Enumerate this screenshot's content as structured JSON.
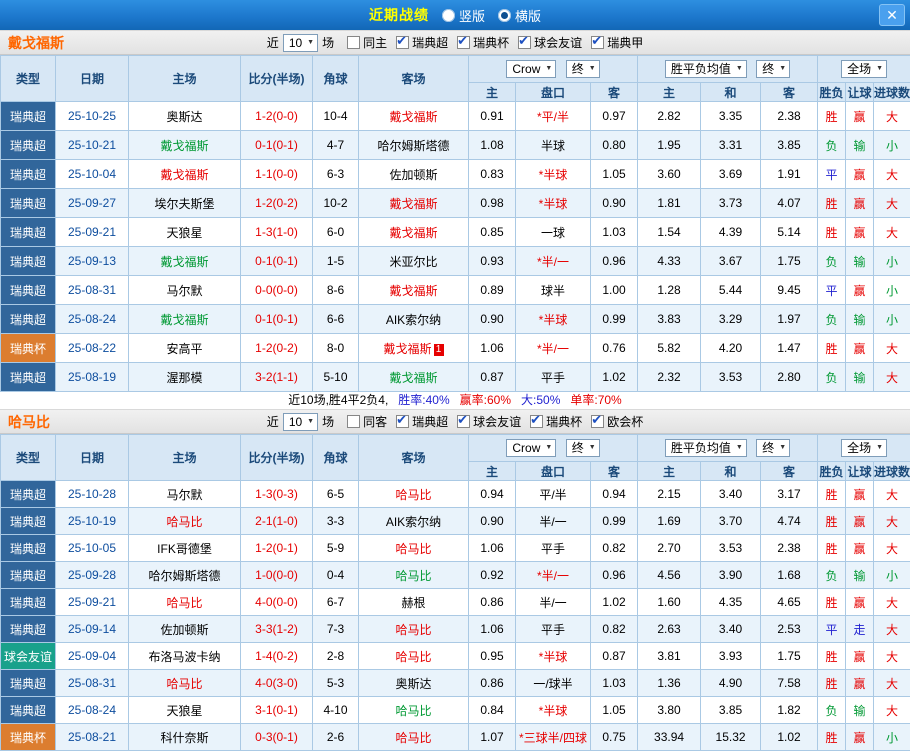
{
  "titlebar": {
    "title": "近期战绩",
    "radios": [
      {
        "key": "vertical",
        "label": "竖版",
        "selected": false
      },
      {
        "key": "horizontal",
        "label": "横版",
        "selected": true
      }
    ]
  },
  "icons": {
    "chevron_down": "▼",
    "close": "✕",
    "check": "✔"
  },
  "palette": {
    "topbar_blue": "#1d78cd",
    "title_yellow": "#ffff00",
    "team_orange": "#ff6600",
    "league_blue": "#31669b",
    "cup_orange": "#dc7d2f",
    "friendly_teal": "#19a18b",
    "win_red": "#e60000",
    "lose_green": "#009933",
    "draw_blue": "#1f1fd0"
  },
  "table_headers": {
    "type": "类型",
    "date": "日期",
    "home": "主场",
    "score": "比分(半场)",
    "corner": "角球",
    "away": "客场",
    "odds_home": "主",
    "handicap": "盘口",
    "odds_away": "客",
    "avg_home": "主",
    "avg_draw": "和",
    "avg_away": "客",
    "result": "胜负",
    "let": "让球",
    "goals": "进球数"
  },
  "sections": [
    {
      "team": "戴戈福斯",
      "filter": {
        "near": "近",
        "count": "10",
        "games": "场",
        "checkboxes": [
          {
            "key": "same-home",
            "label": "同主",
            "checked": false
          },
          {
            "key": "swe-allsvenskan",
            "label": "瑞典超",
            "checked": true
          },
          {
            "key": "swe-cup",
            "label": "瑞典杯",
            "checked": true
          },
          {
            "key": "club-friendly",
            "label": "球会友谊",
            "checked": true
          },
          {
            "key": "swe-superettan",
            "label": "瑞典甲",
            "checked": true
          }
        ]
      },
      "selects": {
        "source": "Crow",
        "time1": "终",
        "avg": "胜平负均值",
        "time2": "终",
        "scope": "全场"
      },
      "rows": [
        {
          "type": "瑞典超",
          "tc": "lg",
          "date": "25-10-25",
          "home": "奥斯达",
          "hc": "k",
          "score": "1-2(0-0)",
          "corner": "10-4",
          "away": "戴戈福斯",
          "ac": "r",
          "oH": "0.91",
          "cap": "*平/半",
          "cc": "r",
          "oA": "0.97",
          "aH": "2.82",
          "aD": "3.35",
          "aA": "2.38",
          "res": "胜",
          "rc": "r",
          "let": "赢",
          "lc": "r",
          "goal": "大",
          "gc": "r"
        },
        {
          "type": "瑞典超",
          "tc": "lg",
          "date": "25-10-21",
          "home": "戴戈福斯",
          "hc": "g",
          "score": "0-1(0-1)",
          "corner": "4-7",
          "away": "哈尔姆斯塔德",
          "ac": "k",
          "oH": "1.08",
          "cap": "半球",
          "cc": "k",
          "oA": "0.80",
          "aH": "1.95",
          "aD": "3.31",
          "aA": "3.85",
          "res": "负",
          "rc": "g",
          "let": "输",
          "lc": "g",
          "goal": "小",
          "gc": "g"
        },
        {
          "type": "瑞典超",
          "tc": "lg",
          "date": "25-10-04",
          "home": "戴戈福斯",
          "hc": "r",
          "score": "1-1(0-0)",
          "corner": "6-3",
          "away": "佐加顿斯",
          "ac": "k",
          "oH": "0.83",
          "cap": "*半球",
          "cc": "r",
          "oA": "1.05",
          "aH": "3.60",
          "aD": "3.69",
          "aA": "1.91",
          "res": "平",
          "rc": "b",
          "let": "赢",
          "lc": "r",
          "goal": "大",
          "gc": "r"
        },
        {
          "type": "瑞典超",
          "tc": "lg",
          "date": "25-09-27",
          "home": "埃尔夫斯堡",
          "hc": "k",
          "score": "1-2(0-2)",
          "corner": "10-2",
          "away": "戴戈福斯",
          "ac": "r",
          "oH": "0.98",
          "cap": "*半球",
          "cc": "r",
          "oA": "0.90",
          "aH": "1.81",
          "aD": "3.73",
          "aA": "4.07",
          "res": "胜",
          "rc": "r",
          "let": "赢",
          "lc": "r",
          "goal": "大",
          "gc": "r"
        },
        {
          "type": "瑞典超",
          "tc": "lg",
          "date": "25-09-21",
          "home": "天狼星",
          "hc": "k",
          "score": "1-3(1-0)",
          "corner": "6-0",
          "away": "戴戈福斯",
          "ac": "r",
          "oH": "0.85",
          "cap": "一球",
          "cc": "k",
          "oA": "1.03",
          "aH": "1.54",
          "aD": "4.39",
          "aA": "5.14",
          "res": "胜",
          "rc": "r",
          "let": "赢",
          "lc": "r",
          "goal": "大",
          "gc": "r"
        },
        {
          "type": "瑞典超",
          "tc": "lg",
          "date": "25-09-13",
          "home": "戴戈福斯",
          "hc": "g",
          "score": "0-1(0-1)",
          "corner": "1-5",
          "away": "米亚尔比",
          "ac": "k",
          "oH": "0.93",
          "cap": "*半/一",
          "cc": "r",
          "oA": "0.96",
          "aH": "4.33",
          "aD": "3.67",
          "aA": "1.75",
          "res": "负",
          "rc": "g",
          "let": "输",
          "lc": "g",
          "goal": "小",
          "gc": "g"
        },
        {
          "type": "瑞典超",
          "tc": "lg",
          "date": "25-08-31",
          "home": "马尔默",
          "hc": "k",
          "score": "0-0(0-0)",
          "corner": "8-6",
          "away": "戴戈福斯",
          "ac": "r",
          "oH": "0.89",
          "cap": "球半",
          "cc": "k",
          "oA": "1.00",
          "aH": "1.28",
          "aD": "5.44",
          "aA": "9.45",
          "res": "平",
          "rc": "b",
          "let": "赢",
          "lc": "r",
          "goal": "小",
          "gc": "g"
        },
        {
          "type": "瑞典超",
          "tc": "lg",
          "date": "25-08-24",
          "home": "戴戈福斯",
          "hc": "g",
          "score": "0-1(0-1)",
          "corner": "6-6",
          "away": "AIK索尔纳",
          "ac": "k",
          "oH": "0.90",
          "cap": "*半球",
          "cc": "r",
          "oA": "0.99",
          "aH": "3.83",
          "aD": "3.29",
          "aA": "1.97",
          "res": "负",
          "rc": "g",
          "let": "输",
          "lc": "g",
          "goal": "小",
          "gc": "g"
        },
        {
          "type": "瑞典杯",
          "tc": "cup",
          "date": "25-08-22",
          "home": "安高平",
          "hc": "k",
          "score": "1-2(0-2)",
          "corner": "8-0",
          "away": "戴戈福斯",
          "ac": "r",
          "badge": "1",
          "oH": "1.06",
          "cap": "*半/一",
          "cc": "r",
          "oA": "0.76",
          "aH": "5.82",
          "aD": "4.20",
          "aA": "1.47",
          "res": "胜",
          "rc": "r",
          "let": "赢",
          "lc": "r",
          "goal": "大",
          "gc": "r"
        },
        {
          "type": "瑞典超",
          "tc": "lg",
          "date": "25-08-19",
          "home": "渥那模",
          "hc": "k",
          "score": "3-2(1-1)",
          "corner": "5-10",
          "away": "戴戈福斯",
          "ac": "g",
          "oH": "0.87",
          "cap": "平手",
          "cc": "k",
          "oA": "1.02",
          "aH": "2.32",
          "aD": "3.53",
          "aA": "2.80",
          "res": "负",
          "rc": "g",
          "let": "输",
          "lc": "g",
          "goal": "大",
          "gc": "r"
        }
      ],
      "summary": [
        {
          "text": "近10场,胜4平2负4,",
          "cls": "k"
        },
        {
          "text": "胜率:40%",
          "cls": "b"
        },
        {
          "text": "赢率:60%",
          "cls": "r"
        },
        {
          "text": "大:50%",
          "cls": "b"
        },
        {
          "text": "单率:70%",
          "cls": "r"
        }
      ]
    },
    {
      "team": "哈马比",
      "filter": {
        "near": "近",
        "count": "10",
        "games": "场",
        "checkboxes": [
          {
            "key": "same-away",
            "label": "同客",
            "checked": false
          },
          {
            "key": "swe-allsvenskan",
            "label": "瑞典超",
            "checked": true
          },
          {
            "key": "club-friendly",
            "label": "球会友谊",
            "checked": true
          },
          {
            "key": "swe-cup",
            "label": "瑞典杯",
            "checked": true
          },
          {
            "key": "conference-league",
            "label": "欧会杯",
            "checked": true
          }
        ]
      },
      "selects": {
        "source": "Crow",
        "time1": "终",
        "avg": "胜平负均值",
        "time2": "终",
        "scope": "全场"
      },
      "rows": [
        {
          "type": "瑞典超",
          "tc": "lg",
          "date": "25-10-28",
          "home": "马尔默",
          "hc": "k",
          "score": "1-3(0-3)",
          "corner": "6-5",
          "away": "哈马比",
          "ac": "r",
          "oH": "0.94",
          "cap": "平/半",
          "cc": "k",
          "oA": "0.94",
          "aH": "2.15",
          "aD": "3.40",
          "aA": "3.17",
          "res": "胜",
          "rc": "r",
          "let": "赢",
          "lc": "r",
          "goal": "大",
          "gc": "r"
        },
        {
          "type": "瑞典超",
          "tc": "lg",
          "date": "25-10-19",
          "home": "哈马比",
          "hc": "r",
          "score": "2-1(1-0)",
          "corner": "3-3",
          "away": "AIK索尔纳",
          "ac": "k",
          "oH": "0.90",
          "cap": "半/一",
          "cc": "k",
          "oA": "0.99",
          "aH": "1.69",
          "aD": "3.70",
          "aA": "4.74",
          "res": "胜",
          "rc": "r",
          "let": "赢",
          "lc": "r",
          "goal": "大",
          "gc": "r"
        },
        {
          "type": "瑞典超",
          "tc": "lg",
          "date": "25-10-05",
          "home": "IFK哥德堡",
          "hc": "k",
          "score": "1-2(0-1)",
          "corner": "5-9",
          "away": "哈马比",
          "ac": "r",
          "oH": "1.06",
          "cap": "平手",
          "cc": "k",
          "oA": "0.82",
          "aH": "2.70",
          "aD": "3.53",
          "aA": "2.38",
          "res": "胜",
          "rc": "r",
          "let": "赢",
          "lc": "r",
          "goal": "大",
          "gc": "r"
        },
        {
          "type": "瑞典超",
          "tc": "lg",
          "date": "25-09-28",
          "home": "哈尔姆斯塔德",
          "hc": "k",
          "score": "1-0(0-0)",
          "corner": "0-4",
          "away": "哈马比",
          "ac": "g",
          "oH": "0.92",
          "cap": "*半/一",
          "cc": "r",
          "oA": "0.96",
          "aH": "4.56",
          "aD": "3.90",
          "aA": "1.68",
          "res": "负",
          "rc": "g",
          "let": "输",
          "lc": "g",
          "goal": "小",
          "gc": "g"
        },
        {
          "type": "瑞典超",
          "tc": "lg",
          "date": "25-09-21",
          "home": "哈马比",
          "hc": "r",
          "score": "4-0(0-0)",
          "corner": "6-7",
          "away": "赫根",
          "ac": "k",
          "oH": "0.86",
          "cap": "半/一",
          "cc": "k",
          "oA": "1.02",
          "aH": "1.60",
          "aD": "4.35",
          "aA": "4.65",
          "res": "胜",
          "rc": "r",
          "let": "赢",
          "lc": "r",
          "goal": "大",
          "gc": "r"
        },
        {
          "type": "瑞典超",
          "tc": "lg",
          "date": "25-09-14",
          "home": "佐加顿斯",
          "hc": "k",
          "score": "3-3(1-2)",
          "corner": "7-3",
          "away": "哈马比",
          "ac": "r",
          "oH": "1.06",
          "cap": "平手",
          "cc": "k",
          "oA": "0.82",
          "aH": "2.63",
          "aD": "3.40",
          "aA": "2.53",
          "res": "平",
          "rc": "b",
          "let": "走",
          "lc": "b",
          "goal": "大",
          "gc": "r"
        },
        {
          "type": "球会友谊",
          "tc": "fr",
          "date": "25-09-04",
          "home": "布洛马波卡纳",
          "hc": "k",
          "score": "1-4(0-2)",
          "corner": "2-8",
          "away": "哈马比",
          "ac": "r",
          "oH": "0.95",
          "cap": "*半球",
          "cc": "r",
          "oA": "0.87",
          "aH": "3.81",
          "aD": "3.93",
          "aA": "1.75",
          "res": "胜",
          "rc": "r",
          "let": "赢",
          "lc": "r",
          "goal": "大",
          "gc": "r"
        },
        {
          "type": "瑞典超",
          "tc": "lg",
          "date": "25-08-31",
          "home": "哈马比",
          "hc": "r",
          "score": "4-0(3-0)",
          "corner": "5-3",
          "away": "奥斯达",
          "ac": "k",
          "oH": "0.86",
          "cap": "一/球半",
          "cc": "k",
          "oA": "1.03",
          "aH": "1.36",
          "aD": "4.90",
          "aA": "7.58",
          "res": "胜",
          "rc": "r",
          "let": "赢",
          "lc": "r",
          "goal": "大",
          "gc": "r"
        },
        {
          "type": "瑞典超",
          "tc": "lg",
          "date": "25-08-24",
          "home": "天狼星",
          "hc": "k",
          "score": "3-1(0-1)",
          "corner": "4-10",
          "away": "哈马比",
          "ac": "g",
          "oH": "0.84",
          "cap": "*半球",
          "cc": "r",
          "oA": "1.05",
          "aH": "3.80",
          "aD": "3.85",
          "aA": "1.82",
          "res": "负",
          "rc": "g",
          "let": "输",
          "lc": "g",
          "goal": "大",
          "gc": "r"
        },
        {
          "type": "瑞典杯",
          "tc": "cup",
          "date": "25-08-21",
          "home": "科什奈斯",
          "hc": "k",
          "score": "0-3(0-1)",
          "corner": "2-6",
          "away": "哈马比",
          "ac": "r",
          "oH": "1.07",
          "cap": "*三球半/四球",
          "cc": "r",
          "oA": "0.75",
          "aH": "33.94",
          "aD": "15.32",
          "aA": "1.02",
          "res": "胜",
          "rc": "r",
          "let": "赢",
          "lc": "r",
          "goal": "小",
          "gc": "g"
        }
      ],
      "summary": null
    }
  ]
}
